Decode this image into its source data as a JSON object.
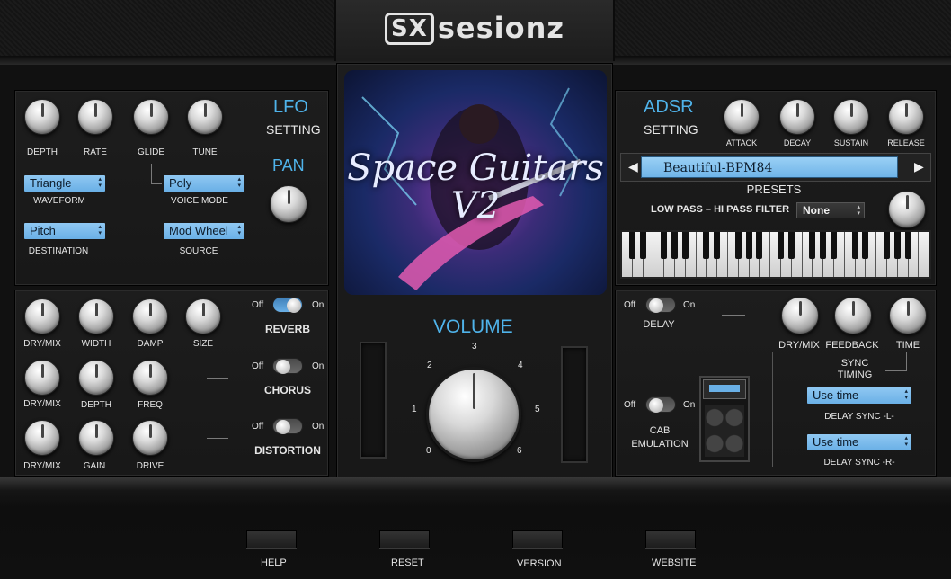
{
  "brand": {
    "logo_mark": "SX",
    "logo_text": "sesionz"
  },
  "artwork": {
    "title_line1": "Space Guitars",
    "title_line2": "V2"
  },
  "lfo": {
    "title": "LFO",
    "subtitle": "SETTING",
    "knobs": [
      "DEPTH",
      "RATE",
      "GLIDE",
      "TUNE"
    ],
    "waveform": {
      "value": "Triangle",
      "label": "WAVEFORM"
    },
    "voice_mode": {
      "value": "Poly",
      "label": "VOICE MODE"
    },
    "destination": {
      "value": "Pitch",
      "label": "DESTINATION"
    },
    "source": {
      "value": "Mod Wheel",
      "label": "SOURCE"
    },
    "pan_label": "PAN"
  },
  "effects": {
    "reverb": {
      "knobs": [
        "DRY/MIX",
        "WIDTH",
        "DAMP",
        "SIZE"
      ],
      "name": "REVERB",
      "state": "on"
    },
    "chorus": {
      "knobs": [
        "DRY/MIX",
        "DEPTH",
        "FREQ"
      ],
      "name": "CHORUS",
      "state": "off"
    },
    "distortion": {
      "knobs": [
        "DRY/MIX",
        "GAIN",
        "DRIVE"
      ],
      "name": "DISTORTION",
      "state": "off"
    },
    "off_label": "Off",
    "on_label": "On"
  },
  "volume": {
    "title": "VOLUME",
    "scale": [
      "0",
      "1",
      "2",
      "3",
      "4",
      "5",
      "6"
    ]
  },
  "adsr": {
    "title": "ADSR",
    "subtitle": "SETTING",
    "knobs": [
      "ATTACK",
      "DECAY",
      "SUSTAIN",
      "RELEASE"
    ]
  },
  "presets": {
    "current": "Beautiful-BPM84",
    "label": "PRESETS",
    "prev_arrow": "◀",
    "next_arrow": "▶"
  },
  "filter": {
    "label": "LOW PASS – HI PASS FILTER",
    "value": "None"
  },
  "delay": {
    "name": "DELAY",
    "state": "off",
    "knobs": [
      "DRY/MIX",
      "FEEDBACK",
      "TIME"
    ],
    "sync_label_1": "SYNC",
    "sync_label_2": "TIMING",
    "sync_l": {
      "value": "Use time",
      "label": "DELAY SYNC -L-"
    },
    "sync_r": {
      "value": "Use time",
      "label": "DELAY SYNC -R-"
    }
  },
  "cab": {
    "label_1": "CAB",
    "label_2": "EMULATION",
    "state": "off"
  },
  "footer": {
    "help": "HELP",
    "reset": "RESET",
    "version": "VERSION",
    "website": "WEBSITE"
  }
}
